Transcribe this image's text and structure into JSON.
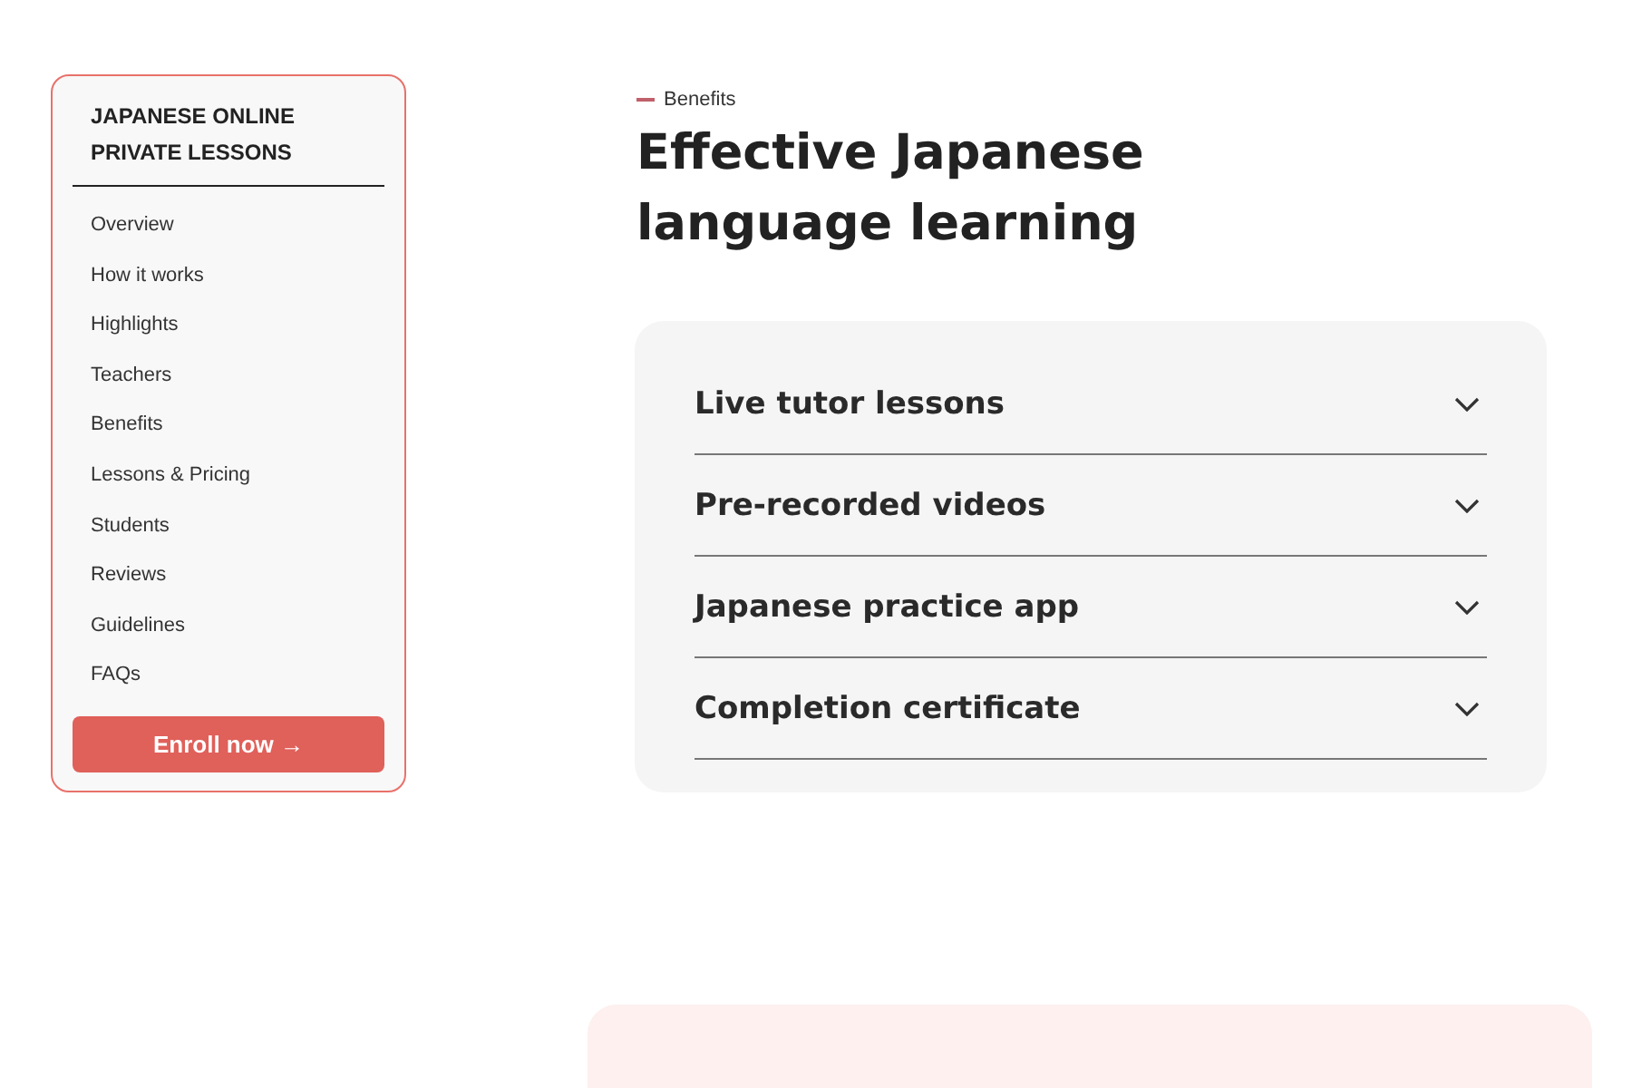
{
  "sidebar": {
    "title": "JAPANESE ONLINE PRIVATE LESSONS",
    "items": [
      "Overview",
      "How it works",
      "Highlights",
      "Teachers",
      "Benefits",
      "Lessons & Pricing",
      "Students",
      "Reviews",
      "Guidelines",
      "FAQs"
    ],
    "button": "Enroll now →"
  },
  "section": {
    "eyebrow": "Benefits",
    "heading": "Effective Japanese language learning"
  },
  "accordion": [
    {
      "label": "Live tutor lessons",
      "expanded": false
    },
    {
      "label": "Pre-recorded videos",
      "expanded": false
    },
    {
      "label": "Japanese practice app",
      "expanded": false
    },
    {
      "label": "Completion certificate",
      "expanded": false
    }
  ]
}
